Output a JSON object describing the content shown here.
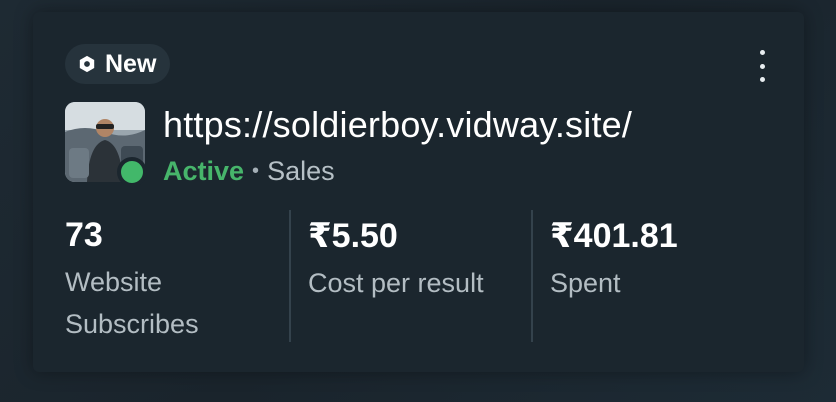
{
  "card": {
    "badge_label": "New",
    "badge_icon": "hexagon-icon",
    "more_icon": "kebab-menu-icon",
    "url": "https://soldierboy.vidway.site/",
    "status": "Active",
    "status_color": "#47b56b",
    "separator": "•",
    "category": "Sales"
  },
  "stats": [
    {
      "value": "73",
      "label_line1": "Website",
      "label_line2": "Subscribes"
    },
    {
      "value": "₹5.50",
      "label_line1": "Cost per result",
      "label_line2": ""
    },
    {
      "value": "₹401.81",
      "label_line1": "Spent",
      "label_line2": ""
    }
  ]
}
